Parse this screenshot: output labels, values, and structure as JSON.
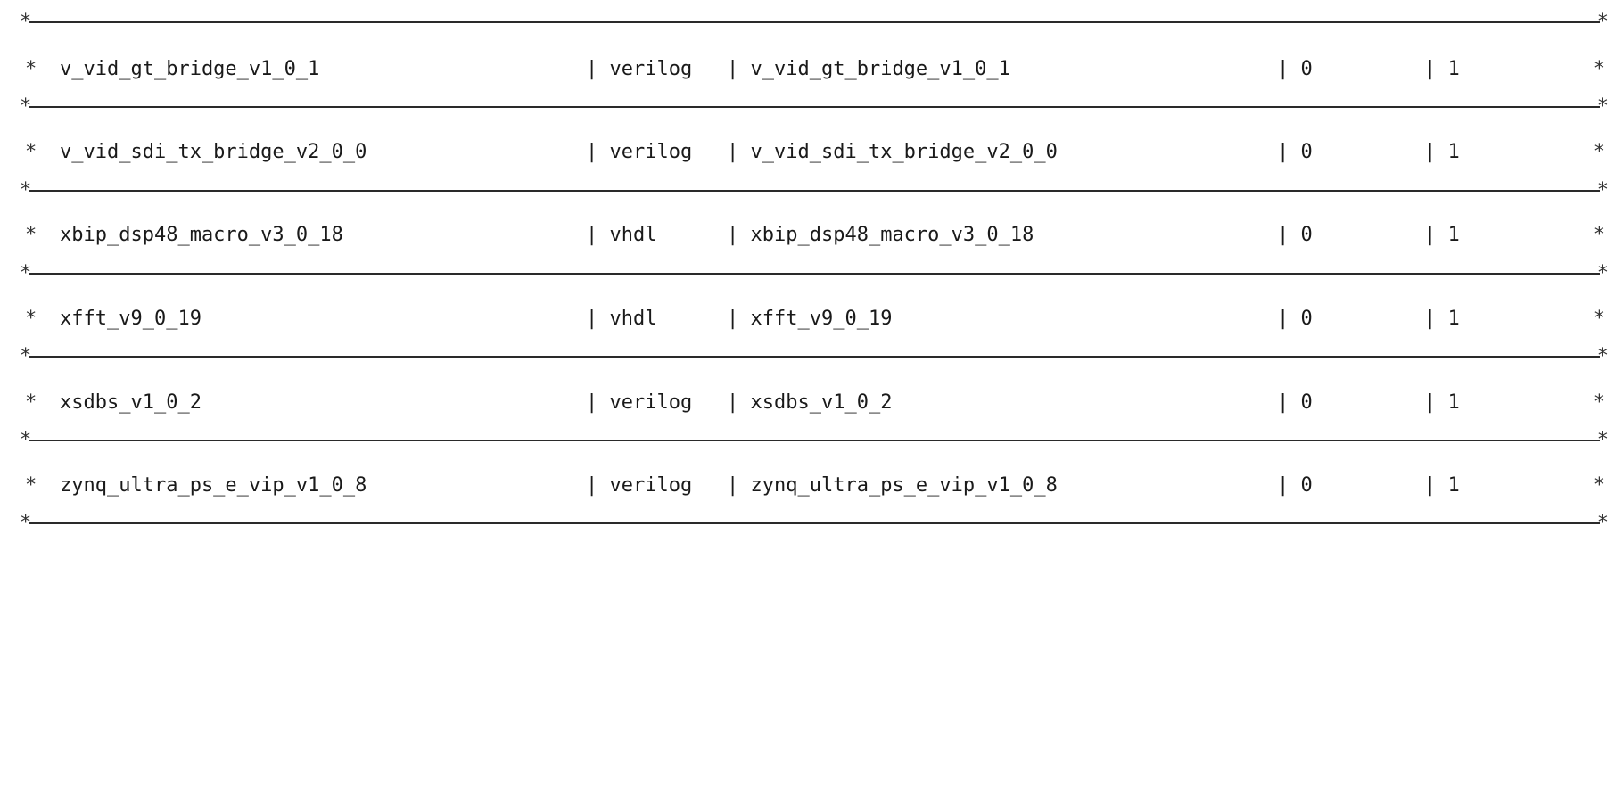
{
  "table": {
    "border_char": "*",
    "cell_separator": "|",
    "rows": [
      {
        "name": "v_vid_gt_bridge_v1_0_1",
        "language": "verilog",
        "library": "v_vid_gt_bridge_v1_0_1",
        "col4": "0",
        "col5": "1"
      },
      {
        "name": "v_vid_sdi_tx_bridge_v2_0_0",
        "language": "verilog",
        "library": "v_vid_sdi_tx_bridge_v2_0_0",
        "col4": "0",
        "col5": "1"
      },
      {
        "name": "xbip_dsp48_macro_v3_0_18",
        "language": "vhdl",
        "library": "xbip_dsp48_macro_v3_0_18",
        "col4": "0",
        "col5": "1"
      },
      {
        "name": "xfft_v9_0_19",
        "language": "vhdl",
        "library": "xfft_v9_0_19",
        "col4": "0",
        "col5": "1"
      },
      {
        "name": "xsdbs_v1_0_2",
        "language": "verilog",
        "library": "xsdbs_v1_0_2",
        "col4": "0",
        "col5": "1"
      },
      {
        "name": "zynq_ultra_ps_e_vip_v1_0_8",
        "language": "verilog",
        "library": "zynq_ultra_ps_e_vip_v1_0_8",
        "col4": "0",
        "col5": "1"
      }
    ]
  },
  "colors": {
    "background": "#ffffff",
    "text": "#1a1a1a",
    "rule": "#2a2a2a"
  }
}
